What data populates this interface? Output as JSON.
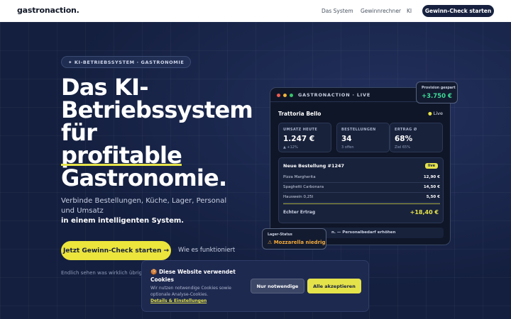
{
  "header": {
    "logo": "gastronaction.",
    "nav": [
      "Das System",
      "Gewinnrechner",
      "KI"
    ],
    "cta": "Gewinn-Check starten"
  },
  "hero": {
    "eyebrow": "✦ KI-BETRIEBSSYSTEM · GASTRONOMIE",
    "headline_lines": [
      "Das KI-",
      "Betriebssystem",
      "für",
      "profitable",
      "Gastronomie."
    ],
    "subtitle": "Verbinde Bestellungen, Küche, Lager, Personal und Umsatz",
    "subtitle_strong": "in einem intelligenten System.",
    "cta": "Jetzt Gewinn-Check starten →",
    "secondary": "Wie es funktioniert",
    "tagline": "Endlich sehen was wirklich übrig bleibt."
  },
  "dashboard": {
    "title": "GASTRONACTION · LIVE",
    "restaurant": "Trattoria Bello",
    "live": "Live",
    "kpis": [
      {
        "label": "UMSATZ HEUTE",
        "value": "1.247 €",
        "sub": "▲ +12%"
      },
      {
        "label": "BESTELLUNGEN",
        "value": "34",
        "sub": "3 offen"
      },
      {
        "label": "ERTRAG Ø",
        "value": "68%",
        "sub": "Ziel 65%"
      }
    ],
    "order": {
      "title": "Neue Bestellung #1247",
      "badge": "live",
      "items": [
        {
          "name": "Pizza Margherita",
          "price": "12,90 €"
        },
        {
          "name": "Spaghetti Carbonara",
          "price": "14,50 €"
        },
        {
          "name": "Hauswein 0,25l",
          "price": "5,50 €"
        }
      ],
      "profit_label": "Echter Ertrag",
      "profit_value": "+18,40 €"
    },
    "strip_text": "n. — Personalbedarf erhöhen"
  },
  "provision": {
    "label": "Provision gespart",
    "value": "+3.750 €"
  },
  "lager": {
    "label": "Lager-Status",
    "value": "⚠ Mozzarella niedrig"
  },
  "cookie": {
    "title": "🍪 Diese Website verwendet Cookies",
    "text": "Wir nutzen notwendige Cookies sowie optionale Analyse-Cookies.",
    "link": "Details & Einstellungen",
    "btn_necessary": "Nur notwendige",
    "btn_accept": "Alle akzeptieren"
  },
  "colors": {
    "navy": "#141f3f",
    "accent_yellow": "#e5e34a",
    "green": "#3ddc97",
    "orange": "#f2a93a"
  }
}
